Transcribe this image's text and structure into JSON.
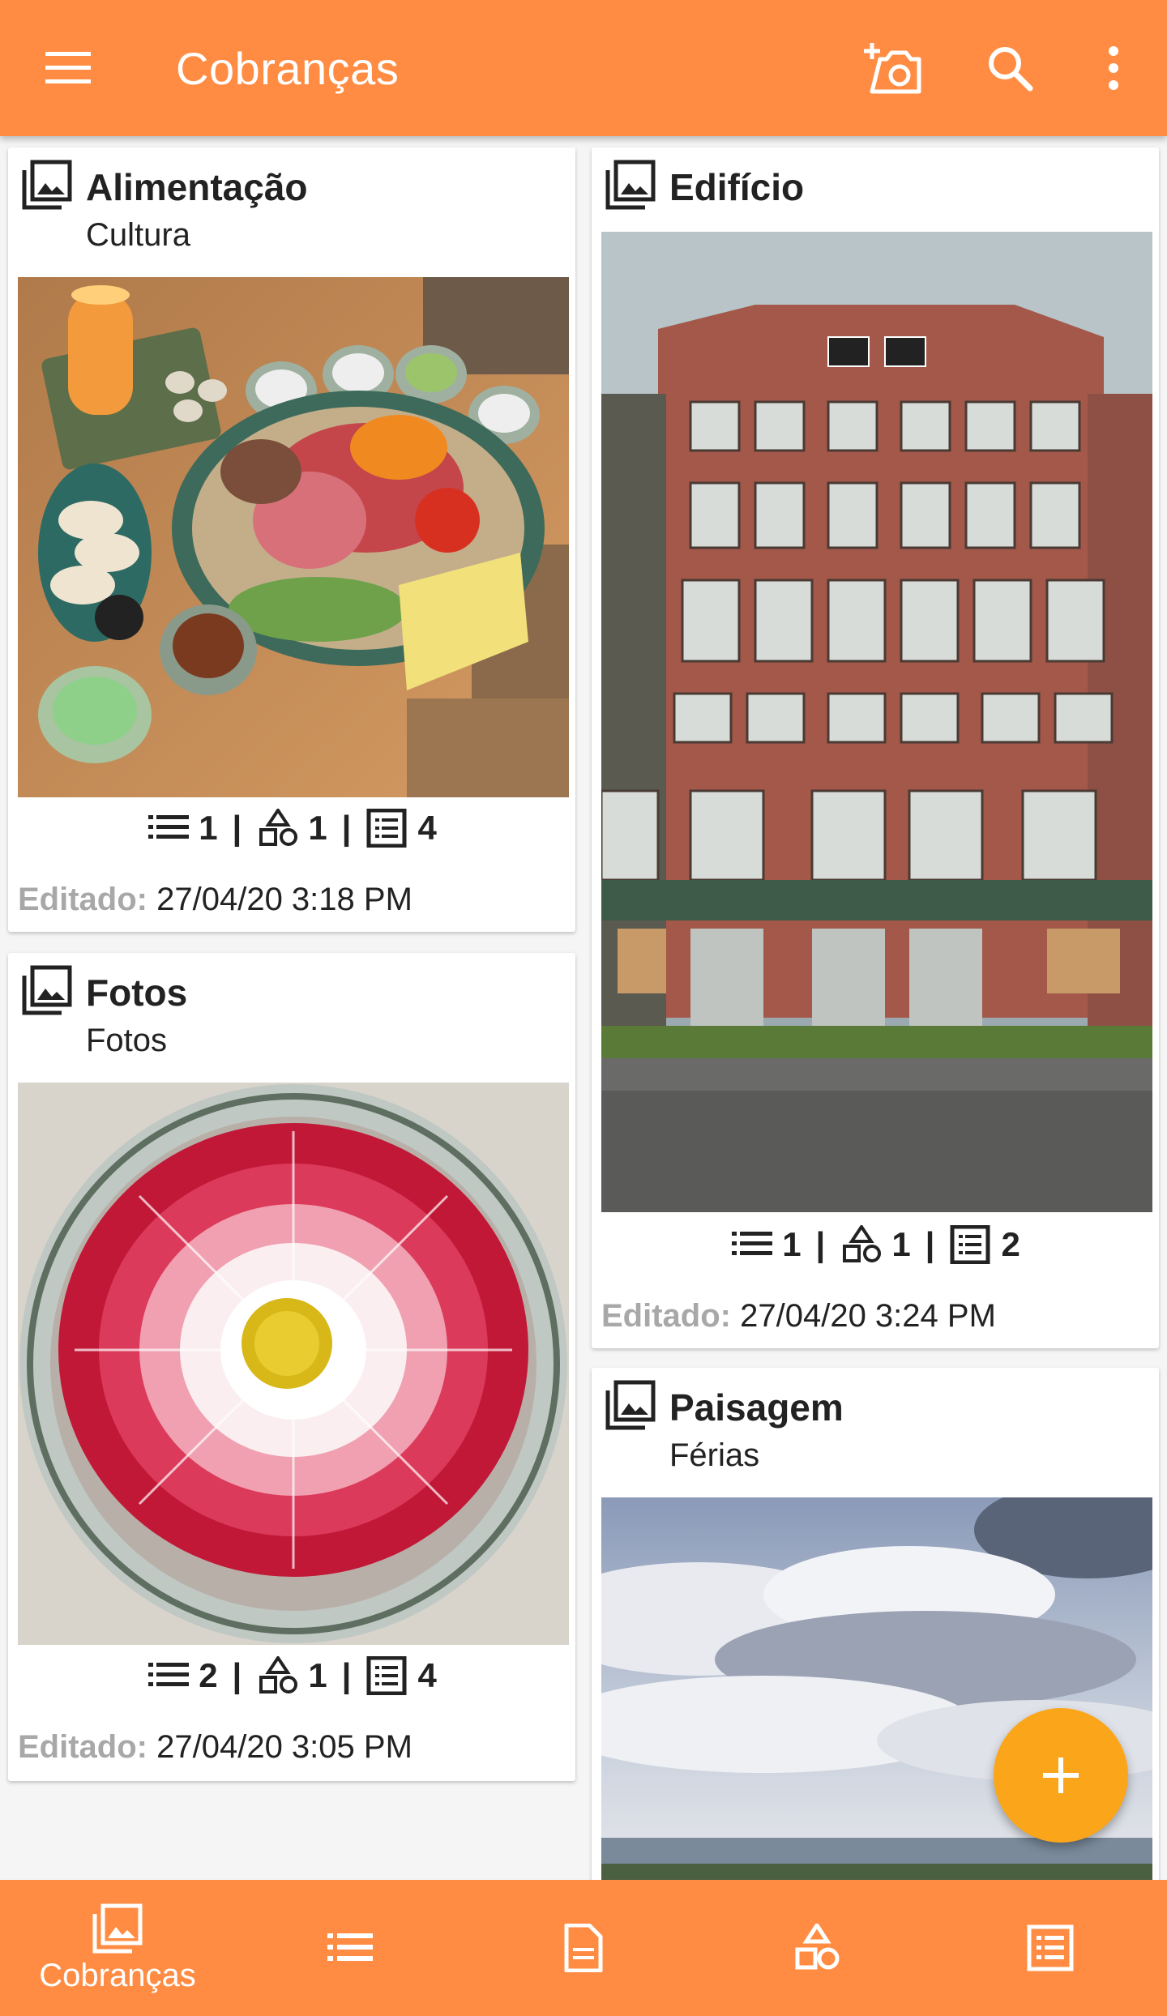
{
  "appbar": {
    "title": "Cobranças",
    "icons": [
      "menu-icon",
      "add-photo-icon",
      "search-icon",
      "more-vert-icon"
    ]
  },
  "cards": [
    {
      "title": "Alimentação",
      "subtitle": "Cultura",
      "photo": "food-platter",
      "stats": {
        "lists": "1",
        "shapes": "1",
        "forms": "4"
      },
      "edited_label": "Editado:",
      "edited_value": "27/04/20 3:18 PM"
    },
    {
      "title": "Fotos",
      "subtitle": "Fotos",
      "photo": "red-flower-bowl",
      "stats": {
        "lists": "2",
        "shapes": "1",
        "forms": "4"
      },
      "edited_label": "Editado:",
      "edited_value": "27/04/20 3:05 PM"
    },
    {
      "title": "Edifício",
      "subtitle": "",
      "photo": "brick-factory",
      "stats": {
        "lists": "1",
        "shapes": "1",
        "forms": "2"
      },
      "edited_label": "Editado:",
      "edited_value": "27/04/20 3:24 PM"
    },
    {
      "title": "Paisagem",
      "subtitle": "Férias",
      "photo": "cloudy-sky-landscape"
    }
  ],
  "stat_separator": "|",
  "fab": {
    "label": "+"
  },
  "bottom_nav": {
    "items": [
      {
        "label": "Cobranças",
        "icon": "collections-icon"
      },
      {
        "label": "",
        "icon": "list-icon"
      },
      {
        "label": "",
        "icon": "document-icon"
      },
      {
        "label": "",
        "icon": "shapes-icon"
      },
      {
        "label": "",
        "icon": "form-icon"
      }
    ]
  },
  "colors": {
    "primary": "#ff8c42",
    "fab": "#fba61a",
    "background": "#f5f5f5",
    "edited_label": "#a8a8a8"
  }
}
